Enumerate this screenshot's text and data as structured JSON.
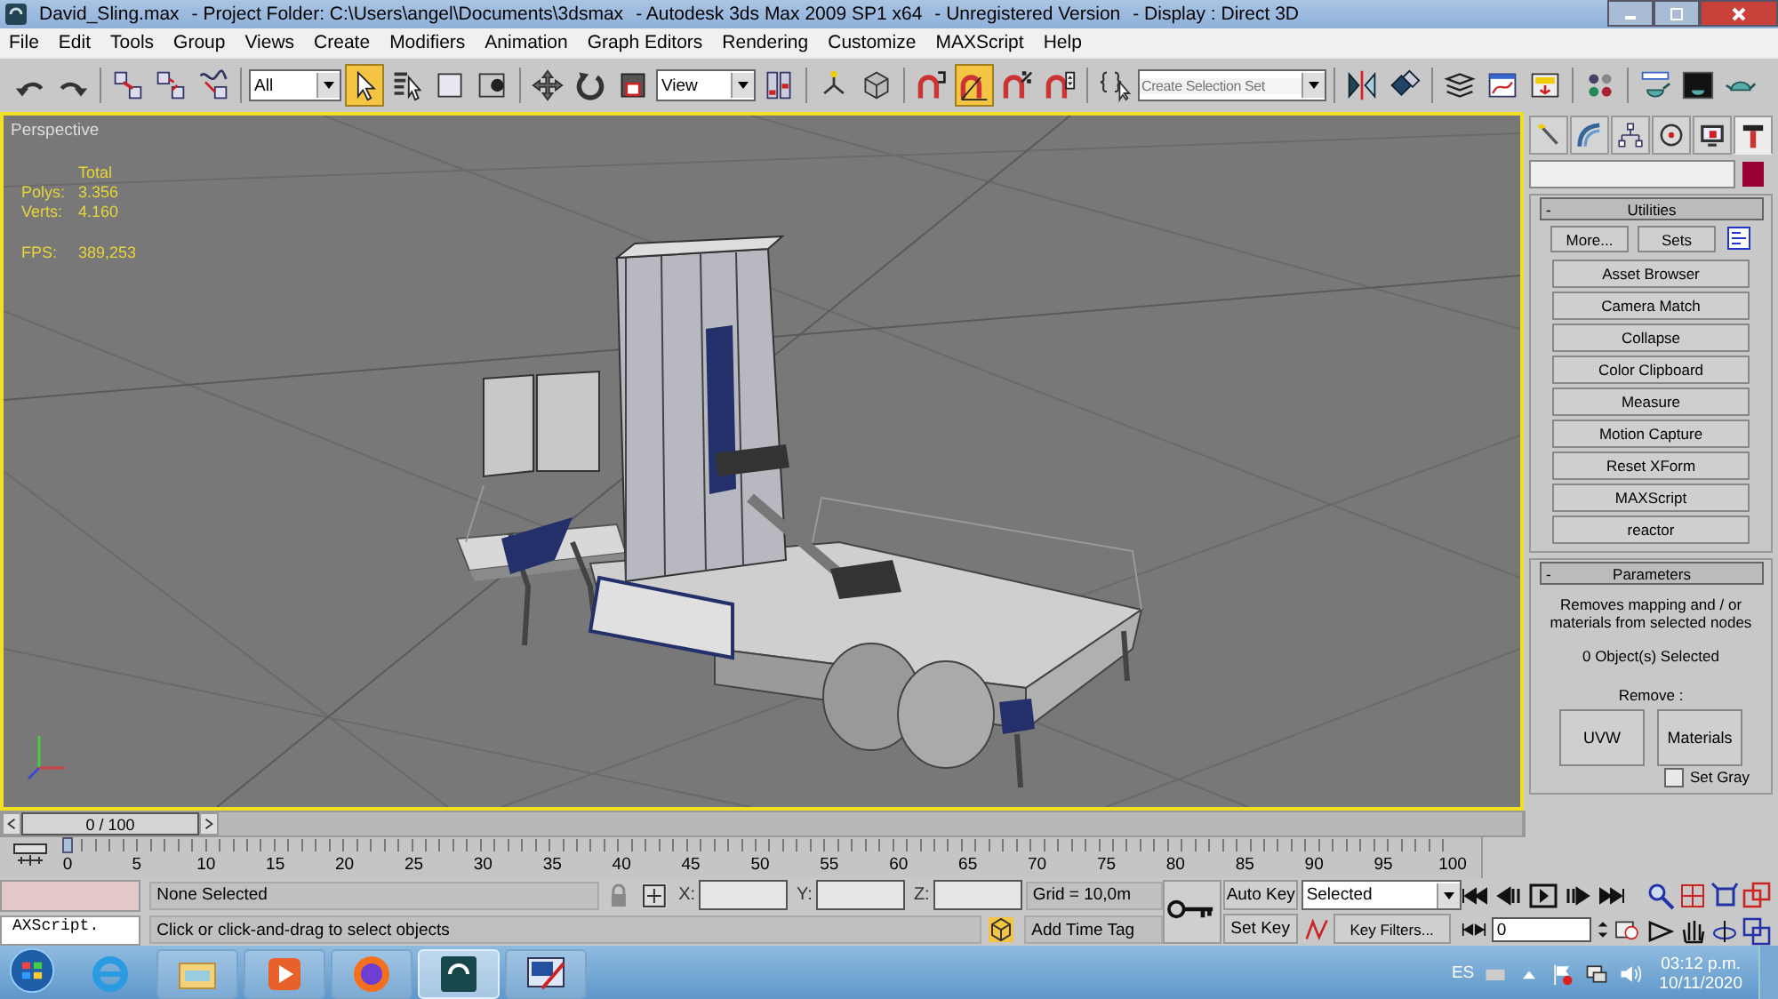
{
  "window": {
    "title_parts": [
      "David_Sling.max",
      "- Project Folder: C:\\Users\\angel\\Documents\\3dsmax",
      "- Autodesk 3ds Max  2009 SP1  x64",
      "- Unregistered Version",
      "- Display : Direct 3D"
    ]
  },
  "menu": [
    "File",
    "Edit",
    "Tools",
    "Group",
    "Views",
    "Create",
    "Modifiers",
    "Animation",
    "Graph Editors",
    "Rendering",
    "Customize",
    "MAXScript",
    "Help"
  ],
  "toolbar": {
    "tool_buttons": [
      {
        "selected": false
      },
      {
        "selected": false
      },
      {
        "selected": false
      },
      {
        "selected": false
      },
      {
        "selected": false
      },
      {
        "selected": true
      },
      {
        "selected": false
      },
      {
        "selected": false
      },
      {
        "selected": false
      },
      {
        "selected": false
      },
      {
        "selected": false
      },
      {
        "selected": false
      },
      {
        "selected": false
      },
      {
        "selected": false
      },
      {
        "selected": false
      },
      {
        "selected": false
      },
      {
        "selected": true
      },
      {
        "selected": false
      },
      {
        "selected": false
      },
      {
        "selected": false
      },
      {
        "selected": false
      },
      {
        "selected": false
      },
      {
        "selected": false
      },
      {
        "selected": false
      },
      {
        "selected": false
      },
      {
        "selected": false
      },
      {
        "selected": false
      },
      {
        "selected": false
      },
      {
        "selected": false
      }
    ],
    "selection_filter": "All",
    "reference_coordinates": "View",
    "named_selection_set": {
      "placeholder": "Create Selection Set"
    }
  },
  "viewport": {
    "label": "Perspective",
    "active": true,
    "stats": {
      "header": "Total",
      "rows": [
        {
          "label": "Polys:",
          "value": "3.356"
        },
        {
          "label": "Verts:",
          "value": "4.160"
        }
      ],
      "fps": {
        "label": "FPS:",
        "value": "389,253"
      }
    }
  },
  "command_panel": {
    "tabs": [
      {
        "selected": false
      },
      {
        "selected": false
      },
      {
        "selected": false
      },
      {
        "selected": false
      },
      {
        "selected": false
      },
      {
        "selected": true
      }
    ],
    "utilities": {
      "toggle": "-",
      "title": "Utilities",
      "more_button": "More...",
      "sets_button": "Sets",
      "buttons": [
        "Asset Browser",
        "Camera Match",
        "Collapse",
        "Color Clipboard",
        "Measure",
        "Motion Capture",
        "Reset XForm",
        "MAXScript",
        "reactor"
      ]
    },
    "parameters": {
      "toggle": "-",
      "title": "Parameters",
      "description": "Removes mapping and / or materials from selected nodes",
      "selection_count": "0 Object(s) Selected",
      "remove_label": "Remove :",
      "buttons": [
        "UVW",
        "Materials"
      ],
      "set_gray": {
        "label": "Set Gray",
        "checked": false
      }
    }
  },
  "time_slider": {
    "position": "0 / 100",
    "ticks": [
      "0",
      "5",
      "10",
      "15",
      "20",
      "25",
      "30",
      "35",
      "40",
      "45",
      "50",
      "55",
      "60",
      "65",
      "70",
      "75",
      "80",
      "85",
      "90",
      "95",
      "100"
    ]
  },
  "status_bar": {
    "listener": "AXScript.",
    "selection": "None Selected",
    "prompt": "Click or click-and-drag to select objects",
    "x_label": "X:",
    "y_label": "Y:",
    "z_label": "Z:",
    "grid": "Grid = 10,0m",
    "time_tag": "Add Time Tag",
    "auto_key": "Auto Key",
    "set_key": "Set Key",
    "key_mode": "Selected",
    "key_filters": "Key Filters...",
    "current_frame": "0"
  },
  "taskbar": {
    "apps": [
      {
        "selected": false
      },
      {
        "selected": false
      },
      {
        "selected": false
      },
      {
        "selected": false
      },
      {
        "selected": true
      },
      {
        "selected": false
      }
    ],
    "language": "ES",
    "time": "03:12 p.m.",
    "date": "10/11/2020"
  }
}
